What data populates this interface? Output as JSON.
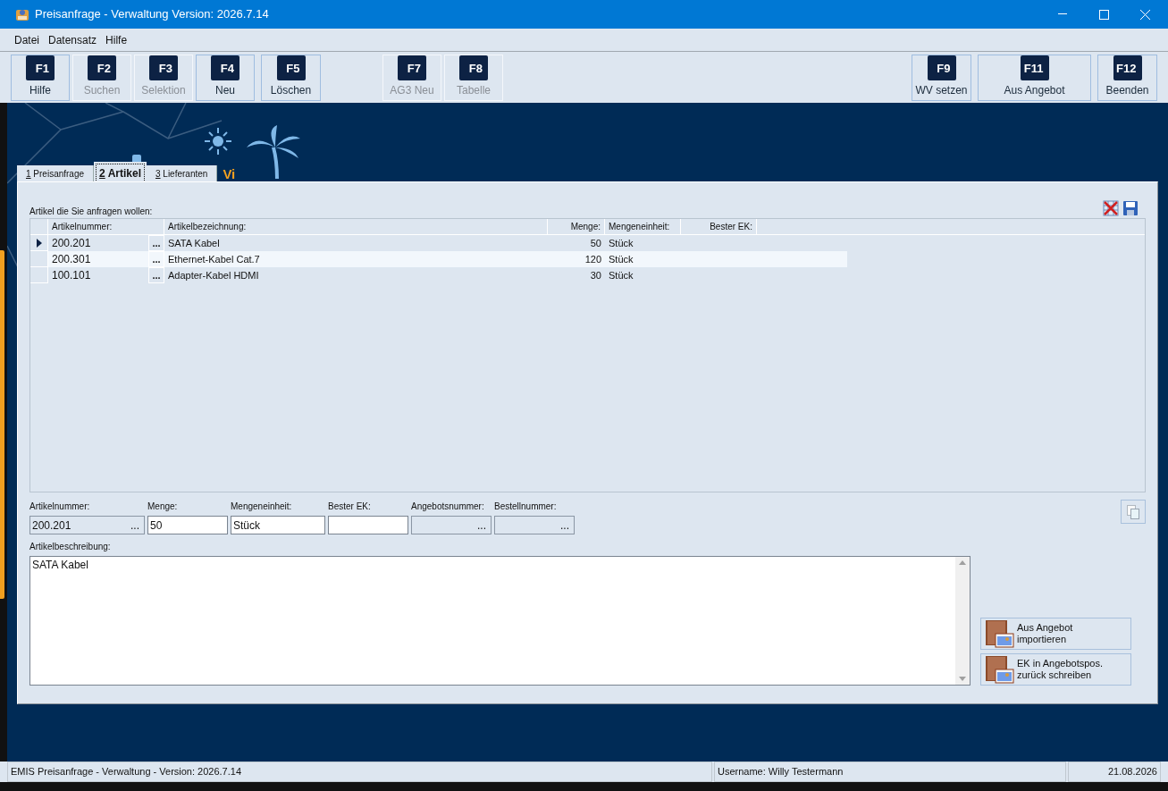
{
  "window": {
    "title": "Preisanfrage - Verwaltung Version: 2026.7.14"
  },
  "menu": [
    "Datei",
    "Datensatz",
    "Hilfe"
  ],
  "toolbar": [
    {
      "key": "F1",
      "label": "Hilfe",
      "disabled": false
    },
    {
      "key": "F2",
      "label": "Suchen",
      "disabled": true
    },
    {
      "key": "F3",
      "label": "Selektion",
      "disabled": true
    },
    {
      "key": "F4",
      "label": "Neu",
      "disabled": false
    },
    {
      "key": "F5",
      "label": "Löschen",
      "disabled": false
    },
    {
      "key": "F7",
      "label": "AG3 Neu",
      "disabled": true
    },
    {
      "key": "F8",
      "label": "Tabelle",
      "disabled": true
    },
    {
      "key": "F9",
      "label": "WV setzen",
      "disabled": false
    },
    {
      "key": "F11",
      "label": "Aus Angebot",
      "disabled": false
    },
    {
      "key": "F12",
      "label": "Beenden",
      "disabled": false
    }
  ],
  "logo_text": "Vi",
  "tabs": [
    {
      "number": "1",
      "label": "Preisanfrage",
      "selected": false
    },
    {
      "number": "2",
      "label": "Artikel",
      "selected": true
    },
    {
      "number": "3",
      "label": "Lieferanten",
      "selected": false
    }
  ],
  "grid": {
    "caption": "Artikel die Sie anfragen wollen:",
    "columns": [
      "Artikelnummer:",
      "Artikelbezeichnung:",
      "Menge:",
      "Mengeneinheit:",
      "Bester EK:"
    ],
    "lookup_button": "...",
    "rows": [
      {
        "selected": true,
        "highlighted": false,
        "cells": [
          "200.201",
          "SATA Kabel",
          "50",
          "Stück"
        ]
      },
      {
        "selected": false,
        "highlighted": true,
        "cells": [
          "200.301",
          "Ethernet-Kabel Cat.7",
          "120",
          "Stück"
        ]
      },
      {
        "selected": false,
        "highlighted": false,
        "cells": [
          "100.101",
          "Adapter-Kabel HDMI",
          "30",
          "Stück"
        ]
      }
    ]
  },
  "fields": [
    {
      "label": "Artikelnummer:",
      "value": "200.201",
      "disabled": true,
      "lookup": true
    },
    {
      "label": "Menge:",
      "value": "50",
      "disabled": false,
      "lookup": false
    },
    {
      "label": "Mengeneinheit:",
      "value": "Stück",
      "disabled": false,
      "lookup": false
    },
    {
      "label": "Bester EK:",
      "disabled": false,
      "lookup": false
    },
    {
      "label": "Angebotsnummer:",
      "disabled": true,
      "lookup": true
    },
    {
      "label": "Bestellnummer:",
      "disabled": true,
      "lookup": true
    }
  ],
  "field_lookup_button": "...",
  "description": {
    "label": "Artikelbeschreibung:",
    "value": "SATA Kabel"
  },
  "side_buttons": [
    "Aus Angebot importieren",
    "EK in Angebotspos. zurück schreiben"
  ],
  "status_bar": [
    "EMIS Preisanfrage - Verwaltung - Version: 2026.7.14",
    "Username: Willy Testermann",
    "21.08.2026"
  ]
}
